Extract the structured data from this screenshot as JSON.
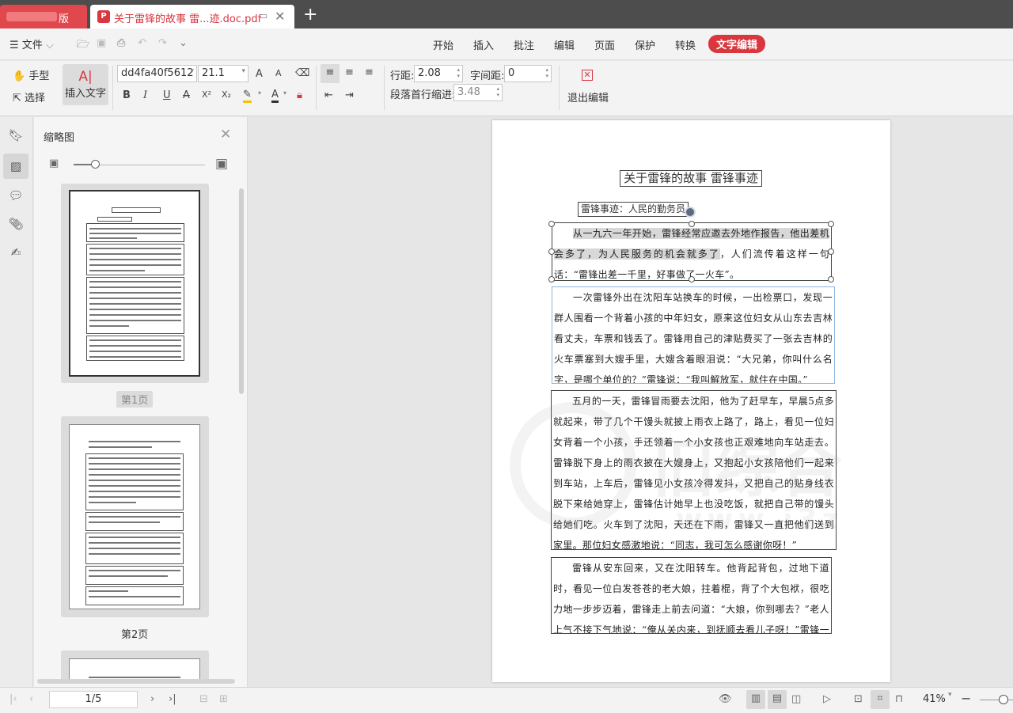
{
  "tabs": {
    "other_label": "版",
    "active_title": "关于雷锋的故事 雷...迹.doc.pdf",
    "add_symbol": "+"
  },
  "menubar": {
    "file_label": "文件",
    "tabs": [
      "开始",
      "插入",
      "批注",
      "编辑",
      "页面",
      "保护",
      "转换"
    ],
    "active_tab": "文字编辑"
  },
  "ribbon": {
    "hand_tool": "手型",
    "select_tool": "选择",
    "insert_text": "插入文字",
    "font_name": "dd4fa40f5612",
    "font_size": "21.1",
    "line_spacing_label": "行距:",
    "line_spacing_value": "2.08",
    "char_spacing_label": "字间距:",
    "char_spacing_value": "0",
    "indent_label": "段落首行缩进:",
    "indent_value": "3.48",
    "exit_edit": "退出编辑",
    "bold": "B",
    "italic": "I",
    "underline": "U",
    "strike": "A",
    "superscript": "X²",
    "subscript": "X₂",
    "grow_font": "A",
    "shrink_font": "A"
  },
  "thumbnails": {
    "title": "缩略图",
    "pages": [
      {
        "label": "第1页",
        "selected": true
      },
      {
        "label": "第2页",
        "selected": false
      }
    ]
  },
  "document": {
    "title": "关于雷锋的故事 雷锋事迹",
    "subtitle": "雷锋事迹：人民的勤务员",
    "p1_hl1": "从一九六一年开始，雷锋经常应邀去外地作报告，他出差机会多",
    "p1_hl2": "了，为人民服务的机会就多了",
    "p1_rest": "，人们流传着这样一句话：“雷锋出差一千里，好事做了一火车”。",
    "p2": "一次雷锋外出在沈阳车站换车的时候，一出检票口，发现一群人围看一个背着小孩的中年妇女，原来这位妇女从山东去吉林看丈夫，车票和钱丢了。雷锋用自己的津贴费买了一张去吉林的火车票塞到大嫂手里，大嫂含着眼泪说：“大兄弟，你叫什么名字，是哪个单位的？”雷锋说：“我叫解放军，就住在中国。”",
    "p3": "五月的一天，雷锋冒雨要去沈阳，他为了赶早车，早晨5点多就起来，带了几个干馒头就披上雨衣上路了，路上，看见一位妇女背着一个小孩，手还领着一个小女孩也正艰难地向车站走去。雷锋脱下身上的雨衣披在大嫂身上，又抱起小女孩陪他们一起来到车站，上车后，雷锋见小女孩冷得发抖，又把自己的贴身线衣脱下来给她穿上，雷锋估计她早上也没吃饭，就把自己带的馒头给她们吃。火车到了沈阳，天还在下雨，雷锋又一直把他们送到家里。那位妇女感激地说：“同志，我可怎么感谢你呀！”",
    "p4": "雷锋从安东回来，又在沈阳转车。他背起背包，过地下道时，看见一位白发苍苍的老大娘，拄着棍，背了个大包袱，很吃力地一步步迈着，雷锋走上前去问道：“大娘，你到哪去？”老人上气不接下气地说：“俺从关内来，到抚顺去看儿子呀！”雷锋一听跟自己同路，立刻"
  },
  "watermark": {
    "text": "旧综合",
    "url": "www.i3z"
  },
  "statusbar": {
    "page_indicator": "1/5",
    "zoom": "41%"
  },
  "colors": {
    "accent": "#d9363e",
    "tabbar": "#4d4d4d"
  }
}
